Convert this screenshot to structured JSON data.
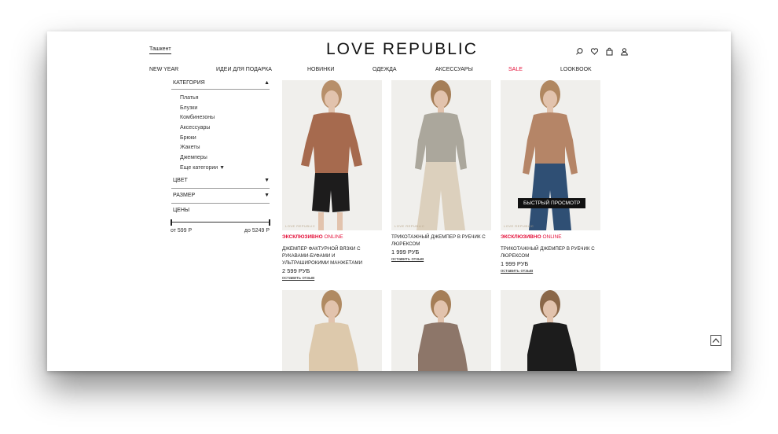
{
  "header": {
    "city": "Ташкент",
    "logo": "LOVE REPUBLIC",
    "icons": [
      "search-icon",
      "heart-icon",
      "bag-icon",
      "user-icon"
    ]
  },
  "nav": {
    "new_year": "NEW YEAR",
    "gifts": "ИДЕИ ДЛЯ ПОДАРКА",
    "new": "НОВИНКИ",
    "clothes": "ОДЕЖДА",
    "accessories": "АКСЕССУАРЫ",
    "sale": "SALE",
    "lookbook": "LOOKBOOK"
  },
  "sidebar": {
    "category_label": "КАТЕГОРИЯ",
    "categories": [
      "Платья",
      "Блузки",
      "Комбинезоны",
      "Аксессуары",
      "Брюки",
      "Жакеты",
      "Джемперы",
      "Еще категории"
    ],
    "color_label": "ЦВЕТ",
    "size_label": "РАЗМЕР",
    "price_label": "ЦЕНЫ",
    "price_from": "от 599 Р",
    "price_to": "до 5249 Р"
  },
  "products": [
    {
      "badge_bold": "ЭКСКЛЮЗИВНО",
      "badge_rest": "ONLINE",
      "title": "ДЖЕМПЕР ФАКТУРНОЙ ВЯЗКИ С РУКАВАМИ-БУФАМИ И УЛЬТРАШИРОКИМИ МАНЖЕТАМИ",
      "price": "2 599 РУБ",
      "review": "оставить отзыв",
      "brand": "LOVE REPUBLIC",
      "top_color": "#a66a4e",
      "bottom_color": "#1d1c1c"
    },
    {
      "badge_bold": "",
      "badge_rest": "",
      "title": "ТРИКОТАЖНЫЙ ДЖЕМПЕР В РУБЧИК С ЛЮРЕКСОМ",
      "price": "1 999 РУБ",
      "review": "оставить отзыв",
      "brand": "LOVE REPUBLIC",
      "top_color": "#aba79c",
      "bottom_color": "#dcd0bd"
    },
    {
      "badge_bold": "ЭКСКЛЮЗИВНО",
      "badge_rest": "ONLINE",
      "title": "ТРИКОТАЖНЫЙ ДЖЕМПЕР В РУБЧИК С ЛЮРЕКСОМ",
      "price": "1 999 РУБ",
      "review": "оставить отзыв",
      "brand": "LOVE REPUBLIC",
      "top_color": "#b58567",
      "bottom_color": "#2f4f74",
      "quick_view": "БЫСТРЫЙ ПРОСМОТР"
    },
    {
      "top_color": "#ddc9ac"
    },
    {
      "top_color": "#8d7669"
    },
    {
      "top_color": "#1c1c1c"
    }
  ]
}
